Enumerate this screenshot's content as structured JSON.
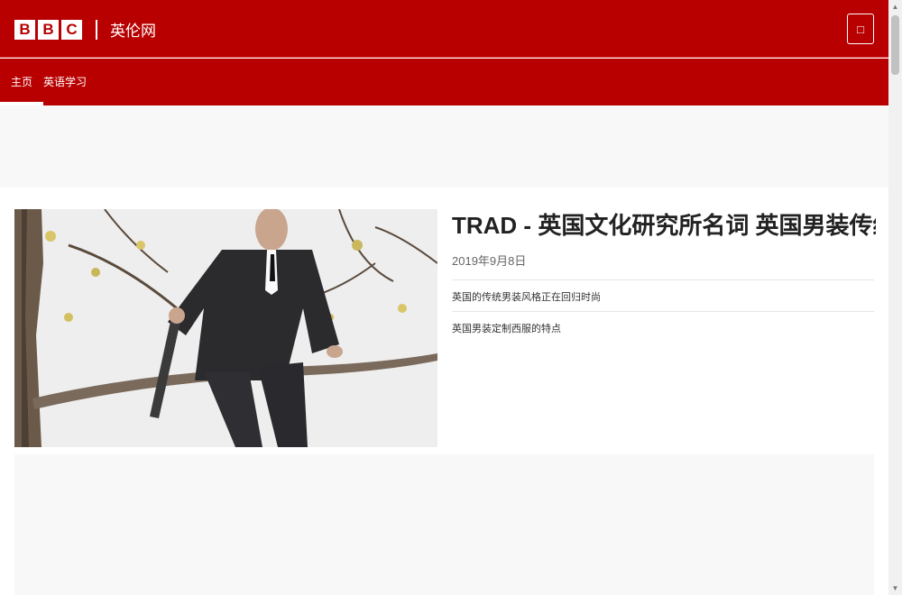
{
  "header": {
    "logo_letters": [
      "B",
      "B",
      "C"
    ],
    "site_name": "英伦网",
    "menu_icon": "menu-icon"
  },
  "nav": {
    "items": [
      {
        "label": "主页",
        "active": true
      },
      {
        "label": "英语学习",
        "active": false
      }
    ]
  },
  "article": {
    "title": "TRAD - 英国文化研究所名词 英国男装传统风格",
    "date": "2019年9月8日",
    "lines": [
      "英国的传统男装风格正在回归时尚",
      "英国男装定制西服的特点"
    ]
  },
  "colors": {
    "brand_red": "#b80000",
    "band_gray": "#f8f8f8"
  }
}
